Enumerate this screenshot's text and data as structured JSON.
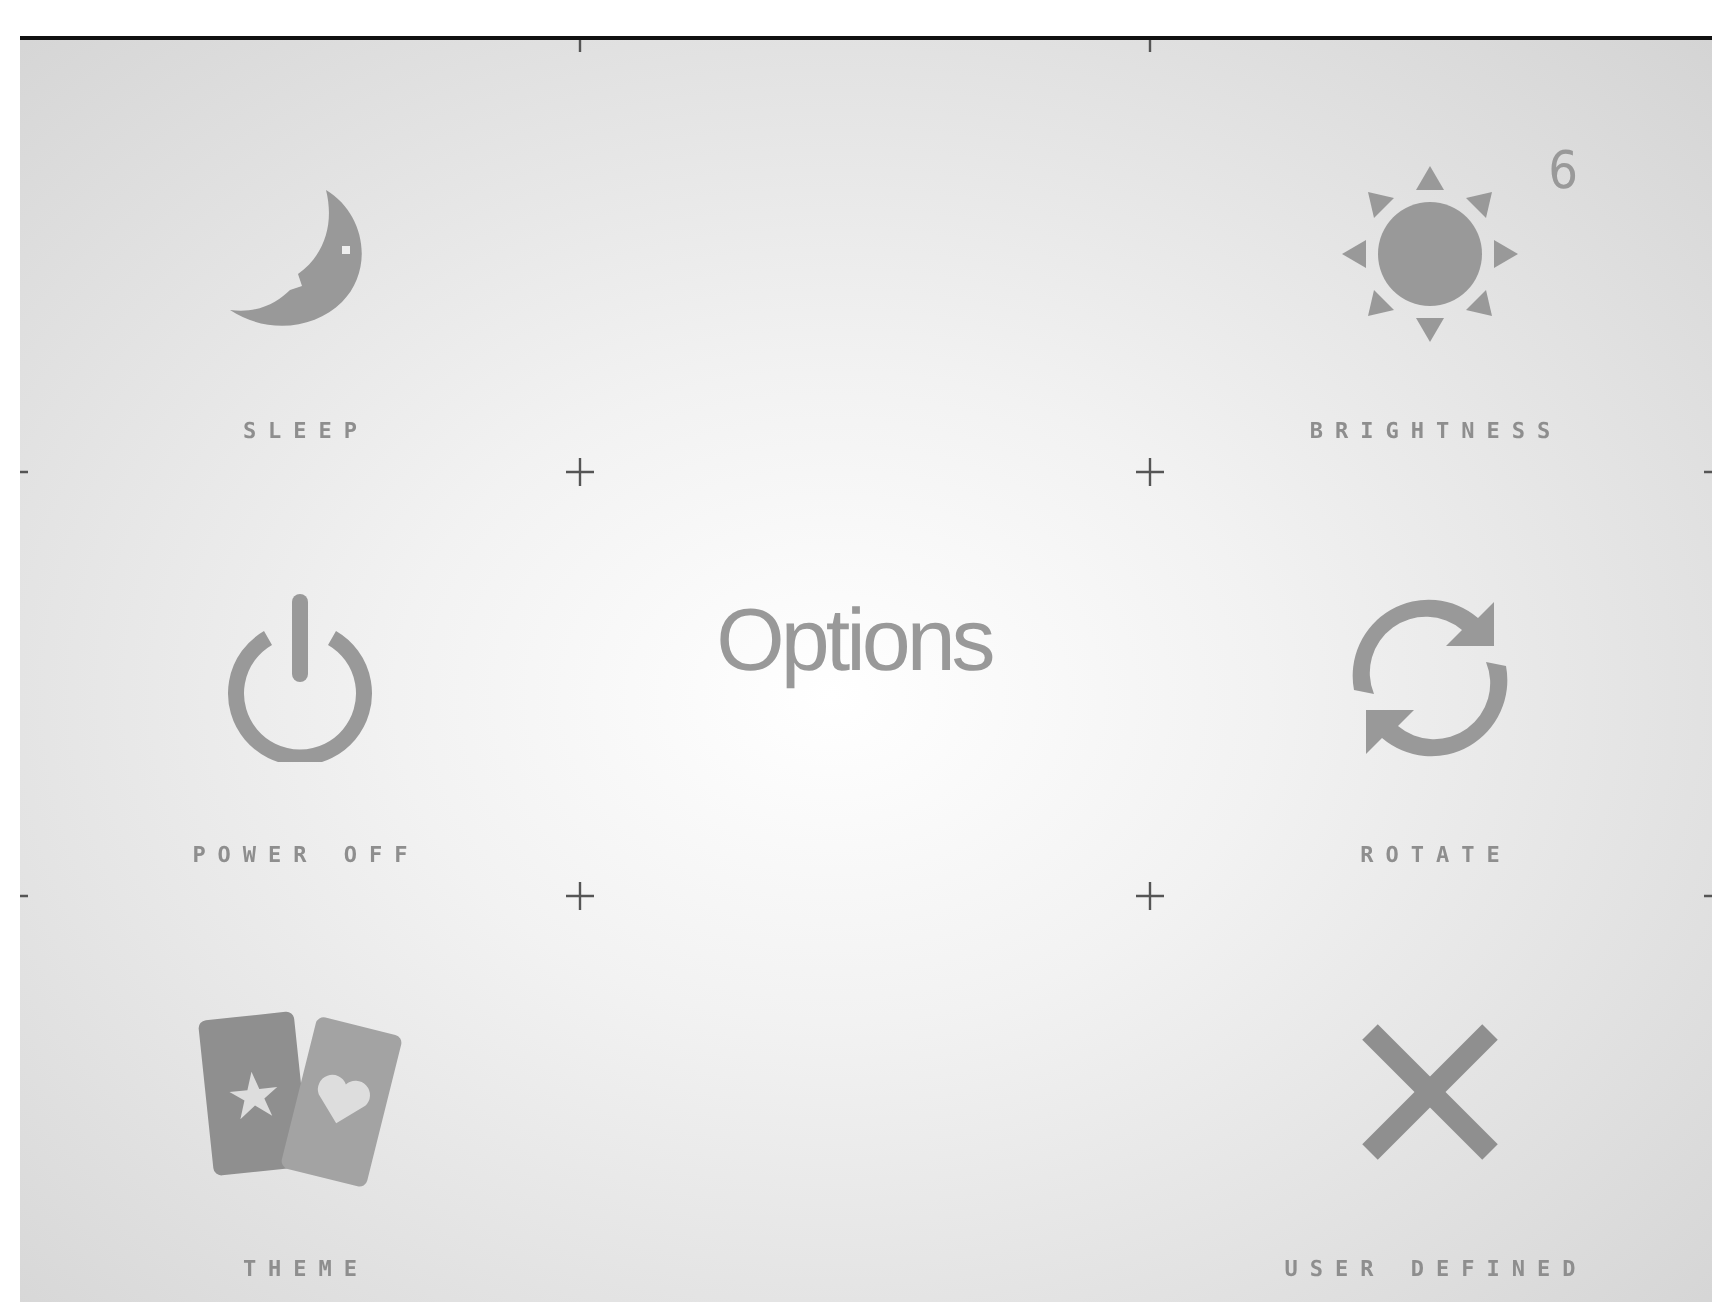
{
  "title": "Options",
  "brightness_value": "6",
  "options": [
    {
      "kind": "sleep",
      "label": "SLEEP"
    },
    {
      "kind": "brightness",
      "label": "BRIGHTNESS"
    },
    {
      "kind": "power",
      "label": "POWER OFF"
    },
    {
      "kind": "rotate",
      "label": "ROTATE"
    },
    {
      "kind": "theme",
      "label": "THEME"
    },
    {
      "kind": "close",
      "label": "USER DEFINED"
    }
  ]
}
